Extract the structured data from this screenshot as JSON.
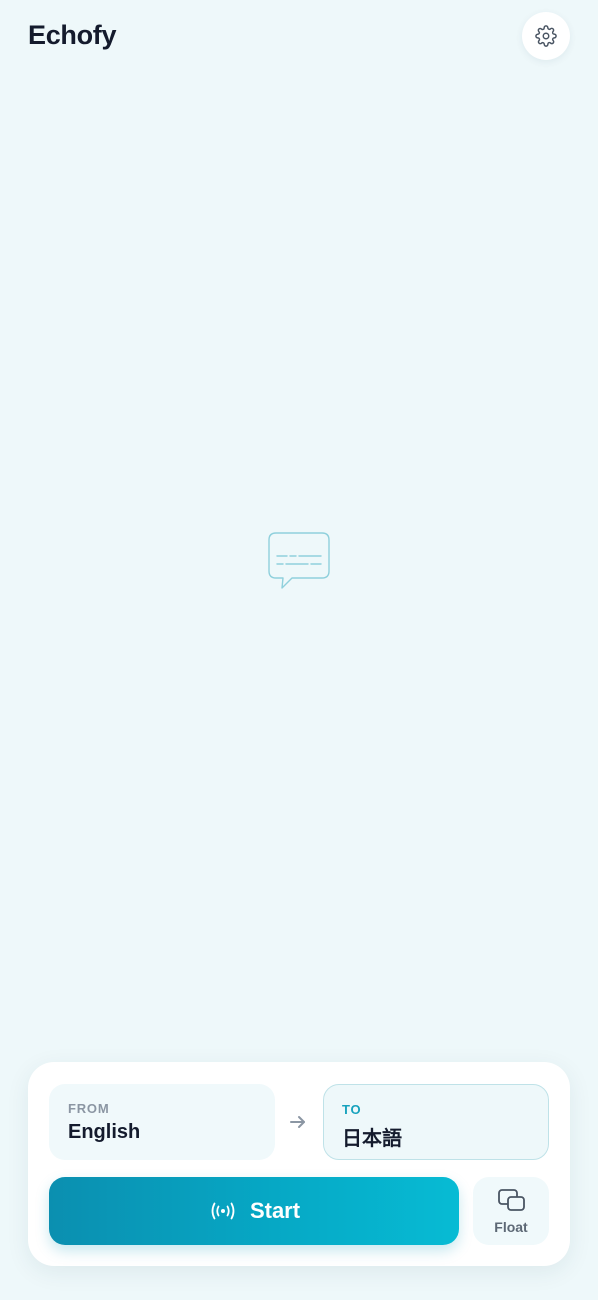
{
  "header": {
    "app_title": "Echofy",
    "settings_icon": "gear-icon"
  },
  "main": {
    "empty_state_icon": "chat-bubble-subtitles-icon"
  },
  "controls": {
    "from": {
      "caption": "FROM",
      "language": "English"
    },
    "swap_icon": "arrow-right-icon",
    "to": {
      "caption": "TO",
      "language": "日本語"
    },
    "start_button": {
      "label": "Start",
      "icon": "broadcast-icon"
    },
    "float_button": {
      "label": "Float",
      "icon": "picture-in-picture-icon"
    }
  },
  "colors": {
    "background": "#eef8fa",
    "accent": "#07a7c4",
    "accent_dark": "#0b8fb0",
    "title_text": "#141b2d"
  }
}
